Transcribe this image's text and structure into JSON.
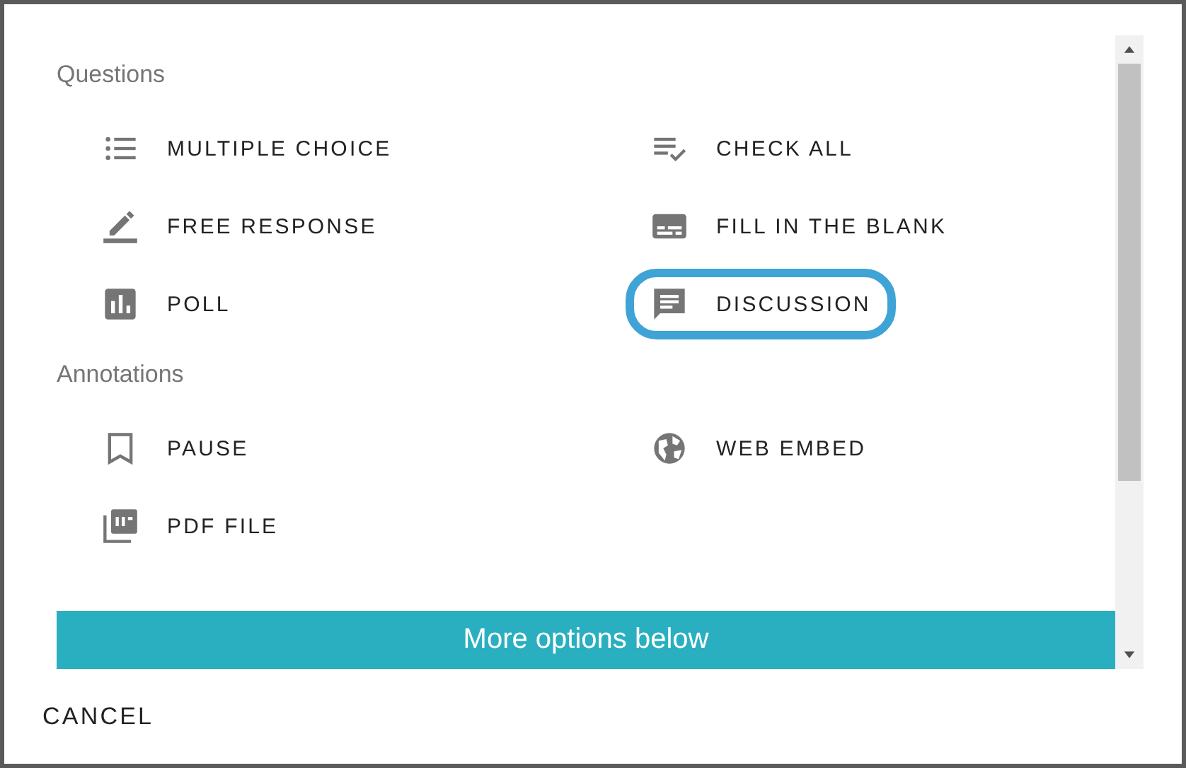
{
  "sections": [
    {
      "title": "Questions",
      "items": [
        {
          "label": "MULTIPLE CHOICE",
          "selected": false
        },
        {
          "label": "CHECK ALL",
          "selected": false
        },
        {
          "label": "FREE RESPONSE",
          "selected": false
        },
        {
          "label": "FILL IN THE BLANK",
          "selected": false
        },
        {
          "label": "POLL",
          "selected": false
        },
        {
          "label": "DISCUSSION",
          "selected": true
        }
      ]
    },
    {
      "title": "Annotations",
      "items": [
        {
          "label": "PAUSE",
          "selected": false
        },
        {
          "label": "WEB EMBED",
          "selected": false
        },
        {
          "label": "PDF FILE",
          "selected": false
        }
      ]
    }
  ],
  "banner": "More options below",
  "cancel": "CANCEL"
}
